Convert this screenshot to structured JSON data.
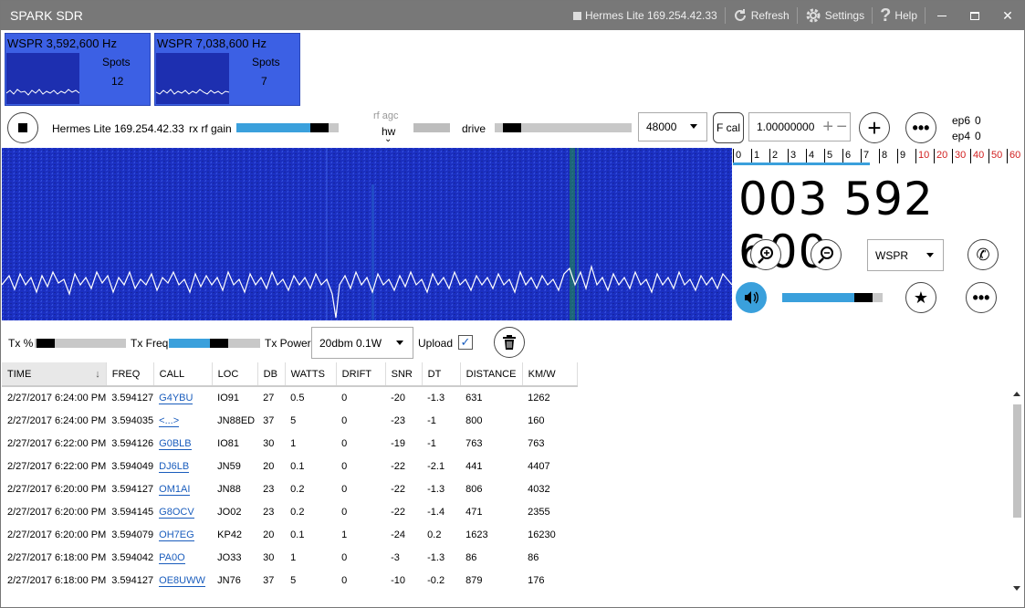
{
  "app": {
    "title": "SPARK SDR",
    "radio_status": "Hermes Lite 169.254.42.33",
    "refresh_label": "Refresh",
    "settings_label": "Settings",
    "help_label": "Help"
  },
  "bands": [
    {
      "title": "WSPR 3,592,600 Hz",
      "spots_label": "Spots",
      "spots": "12"
    },
    {
      "title": "WSPR 7,038,600 Hz",
      "spots_label": "Spots",
      "spots": "7"
    }
  ],
  "controls": {
    "radio_name": "Hermes Lite 169.254.42.33",
    "rx_rf_gain_label": "rx rf gain",
    "rx_rf_gain_level": 0.72,
    "rf_agc_label": "rf agc",
    "rf_agc_value": "hw",
    "drive_label": "drive",
    "drive_level": 0.06,
    "sample_rate": "48000",
    "fcal_label": "F cal",
    "fcal_value": "1.00000000",
    "ep6_label": "ep6",
    "ep6_value": "0",
    "ep4_label": "ep4",
    "ep4_value": "0"
  },
  "scale": [
    "0",
    "1",
    "2",
    "3",
    "4",
    "5",
    "6",
    "7",
    "8",
    "9",
    "10",
    "20",
    "30",
    "40",
    "50",
    "60"
  ],
  "vfo": {
    "frequency": "003 592 600",
    "mode": "WSPR",
    "volume_level": 0.72
  },
  "tx": {
    "tx_pct_label": "Tx %",
    "tx_pct_level": 0.02,
    "tx_freq_label": "Tx Freq",
    "tx_freq_level": 0.45,
    "tx_power_label": "Tx Power",
    "tx_power_value": "20dbm 0.1W",
    "upload_label": "Upload",
    "upload_checked": true
  },
  "table": {
    "columns": [
      "TIME",
      "FREQ",
      "CALL",
      "LOC",
      "DB",
      "WATTS",
      "DRIFT",
      "SNR",
      "DT",
      "DISTANCE",
      "KM/W"
    ],
    "rows": [
      [
        "2/27/2017 6:24:00 PM",
        "3.594127",
        "G4YBU",
        "IO91",
        "27",
        "0.5",
        "0",
        "-20",
        "-1.3",
        "631",
        "1262"
      ],
      [
        "2/27/2017 6:24:00 PM",
        "3.594035",
        "<...>",
        "JN88ED",
        "37",
        "5",
        "0",
        "-23",
        "-1",
        "800",
        "160"
      ],
      [
        "2/27/2017 6:22:00 PM",
        "3.594126",
        "G0BLB",
        "IO81",
        "30",
        "1",
        "0",
        "-19",
        "-1",
        "763",
        "763"
      ],
      [
        "2/27/2017 6:22:00 PM",
        "3.594049",
        "DJ6LB",
        "JN59",
        "20",
        "0.1",
        "0",
        "-22",
        "-2.1",
        "441",
        "4407"
      ],
      [
        "2/27/2017 6:20:00 PM",
        "3.594127",
        "OM1AI",
        "JN88",
        "23",
        "0.2",
        "0",
        "-22",
        "-1.3",
        "806",
        "4032"
      ],
      [
        "2/27/2017 6:20:00 PM",
        "3.594145",
        "G8OCV",
        "JO02",
        "23",
        "0.2",
        "0",
        "-22",
        "-1.4",
        "471",
        "2355"
      ],
      [
        "2/27/2017 6:20:00 PM",
        "3.594079",
        "OH7EG",
        "KP42",
        "20",
        "0.1",
        "1",
        "-24",
        "0.2",
        "1623",
        "16230"
      ],
      [
        "2/27/2017 6:18:00 PM",
        "3.594042",
        "PA0O",
        "JO33",
        "30",
        "1",
        "0",
        "-3",
        "-1.3",
        "86",
        "86"
      ],
      [
        "2/27/2017 6:18:00 PM",
        "3.594127",
        "OE8UWW",
        "JN76",
        "37",
        "5",
        "0",
        "-10",
        "-0.2",
        "879",
        "176"
      ]
    ]
  },
  "colors": {
    "titlebar": "#787878",
    "band_tile": "#3c60e4",
    "waterfall": "#1b2fc0",
    "accent": "#3aa0dc",
    "link": "#1a5dbd",
    "scale_red": "#d22020"
  }
}
